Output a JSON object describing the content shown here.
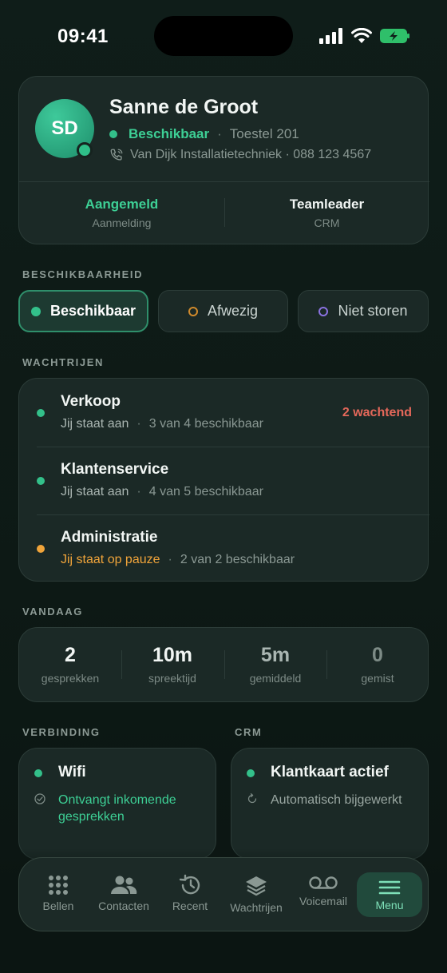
{
  "status_bar": {
    "time": "09:41"
  },
  "profile": {
    "initials": "SD",
    "name": "Sanne de Groot",
    "status": "Beschikbaar",
    "extension": "Toestel 201",
    "company_line": "Van Dijk Installatietechniek · 088 123 4567",
    "integrations": [
      {
        "title": "Aangemeld",
        "subtitle": "Aanmelding",
        "color": "#3dcf95"
      },
      {
        "title": "Teamleader",
        "subtitle": "CRM",
        "color": "#f2f6f4"
      }
    ]
  },
  "availability": {
    "label": "BESCHIKBAARHEID",
    "options": [
      {
        "label": "Beschikbaar",
        "selected": true
      },
      {
        "label": "Afwezig",
        "selected": false
      },
      {
        "label": "Niet storen",
        "selected": false
      }
    ]
  },
  "queues": {
    "label": "WACHTRIJEN",
    "items": [
      {
        "name": "Verkoop",
        "membership": "Jij staat aan",
        "availability": "3 van 4 beschikbaar",
        "waiting": "2 wachtend",
        "status_color": "#33c08a"
      },
      {
        "name": "Klantenservice",
        "membership": "Jij staat aan",
        "availability": "4 van 5 beschikbaar",
        "waiting": "",
        "status_color": "#33c08a"
      },
      {
        "name": "Administratie",
        "membership": "Jij staat op pauze",
        "availability": "2 van 2 beschikbaar",
        "waiting": "",
        "status_color": "#f0a43a"
      }
    ]
  },
  "today": {
    "label": "VANDAAG",
    "stats": [
      {
        "value": "2",
        "label": "gesprekken"
      },
      {
        "value": "10m",
        "label": "spreektijd"
      },
      {
        "value": "5m",
        "label": "gemiddeld"
      },
      {
        "value": "0",
        "label": "gemist"
      }
    ]
  },
  "connection": {
    "label": "VERBINDING",
    "title": "Wifi",
    "subtitle": "Ontvangt inkomende gesprekken"
  },
  "crm": {
    "label": "CRM",
    "title": "Klantkaart actief",
    "subtitle": "Automatisch bijgewerkt"
  },
  "tabbar": {
    "tabs": [
      {
        "label": "Bellen",
        "icon": "keypad-icon"
      },
      {
        "label": "Contacten",
        "icon": "contacts-icon"
      },
      {
        "label": "Recent",
        "icon": "history-icon"
      },
      {
        "label": "Wachtrijen",
        "icon": "layers-icon"
      },
      {
        "label": "Voicemail",
        "icon": "voicemail-icon"
      },
      {
        "label": "Menu",
        "icon": "menu-icon",
        "active": true
      }
    ]
  },
  "colors": {
    "accent": "#33c08a",
    "warning": "#f0a43a",
    "danger": "#e5685a",
    "background": "#0e1a17"
  }
}
